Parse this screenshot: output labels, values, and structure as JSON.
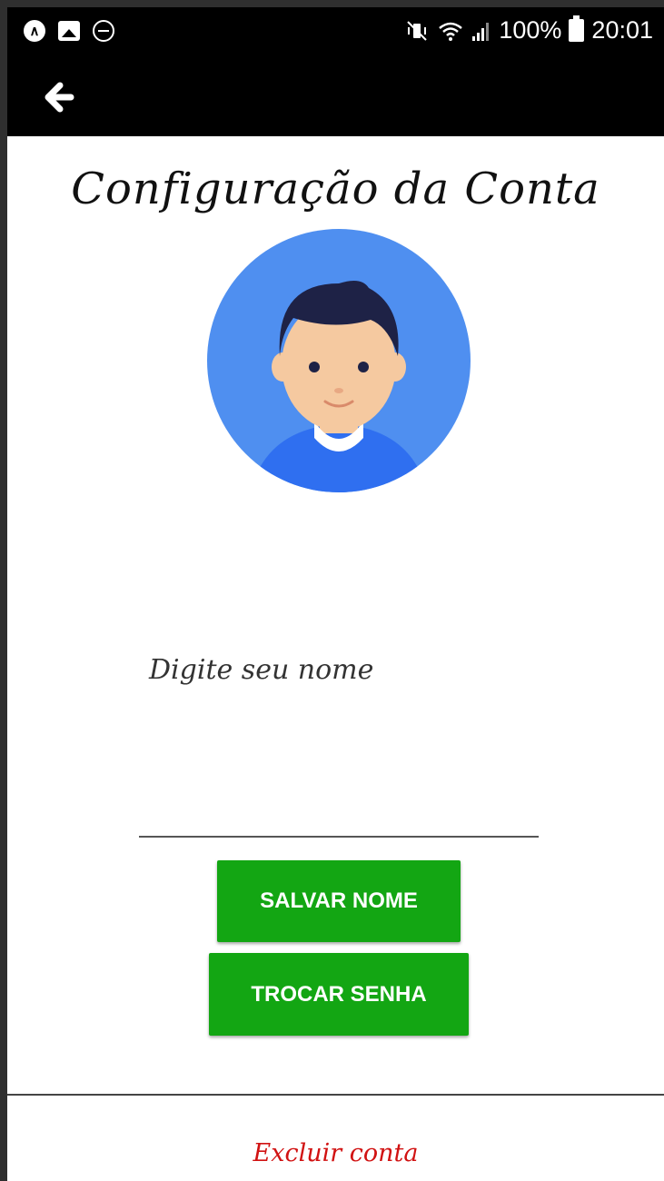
{
  "status_bar": {
    "left_icons": [
      "android-auto-icon",
      "image-icon",
      "do-not-disturb-icon"
    ],
    "right_icons": [
      "mute-vibrate-icon",
      "wifi-icon",
      "signal-icon",
      "battery-icon"
    ],
    "battery": "100%",
    "time": "20:01",
    "colors": {
      "background": "#000000",
      "foreground": "#ffffff"
    }
  },
  "app_bar": {
    "back_icon": "arrow-left-icon"
  },
  "page": {
    "title": "Configuração da Conta",
    "avatar": {
      "icon": "user-avatar-icon",
      "background_color": "#4f8ff0"
    },
    "name_input": {
      "placeholder": "Digite seu nome",
      "value": ""
    },
    "save_button": "SALVAR NOME",
    "password_button": "TROCAR SENHA",
    "delete_link": "Excluir conta"
  },
  "colors": {
    "button": "#13a613",
    "delete_text": "#d11212",
    "background": "#ffffff"
  }
}
